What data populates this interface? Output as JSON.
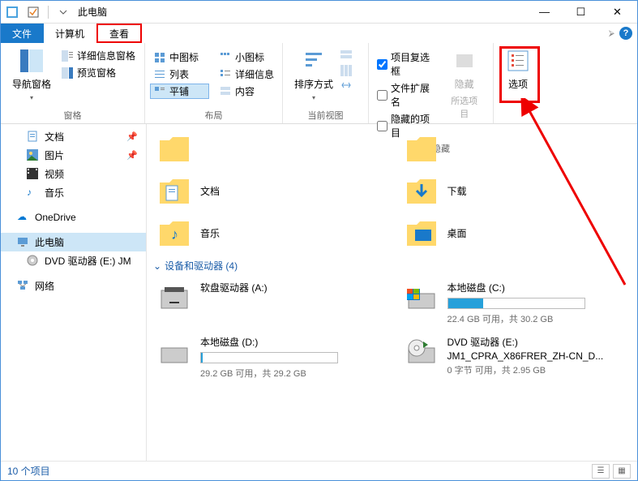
{
  "window": {
    "title": "此电脑",
    "min": "—",
    "max": "☐",
    "close": "✕"
  },
  "tabs": {
    "file": "文件",
    "computer": "计算机",
    "view": "查看"
  },
  "ribbon": {
    "panes": {
      "nav_pane": "导航窗格",
      "preview_pane": "预览窗格",
      "detail_pane": "详细信息窗格",
      "label": "窗格"
    },
    "layout": {
      "medium_icons": "中图标",
      "small_icons": "小图标",
      "list": "列表",
      "details": "详细信息",
      "tiles": "平铺",
      "content": "内容",
      "label": "布局"
    },
    "current_view": {
      "sort": "排序方式",
      "label": "当前视图"
    },
    "show_hide": {
      "checkboxes": "项目复选框",
      "extensions": "文件扩展名",
      "hidden": "隐藏的项目",
      "hide": "隐藏",
      "selected": "所选项目",
      "label": "显示/隐藏"
    },
    "options": "选项"
  },
  "sidebar": {
    "documents": "文档",
    "pictures": "图片",
    "videos": "视频",
    "music": "音乐",
    "onedrive": "OneDrive",
    "this_pc": "此电脑",
    "dvd": "DVD 驱动器 (E:) JM",
    "network": "网络"
  },
  "content": {
    "folders": {
      "documents": "文档",
      "downloads": "下载",
      "music": "音乐",
      "desktop": "桌面"
    },
    "devices_header": "设备和驱动器 (4)",
    "drives": {
      "floppy": {
        "name": "软盘驱动器 (A:)"
      },
      "c": {
        "name": "本地磁盘 (C:)",
        "info": "22.4 GB 可用，共 30.2 GB",
        "pct": 26
      },
      "d": {
        "name": "本地磁盘 (D:)",
        "info": "29.2 GB 可用，共 29.2 GB",
        "pct": 1
      },
      "dvd": {
        "name": "DVD 驱动器 (E:)",
        "sub": "JM1_CPRA_X86FRER_ZH-CN_D...",
        "info": "0 字节 可用，共 2.95 GB"
      }
    }
  },
  "status": {
    "text": "10 个项目"
  },
  "annotations": {
    "view_tab_box": true,
    "options_box": true,
    "arrow": true
  }
}
